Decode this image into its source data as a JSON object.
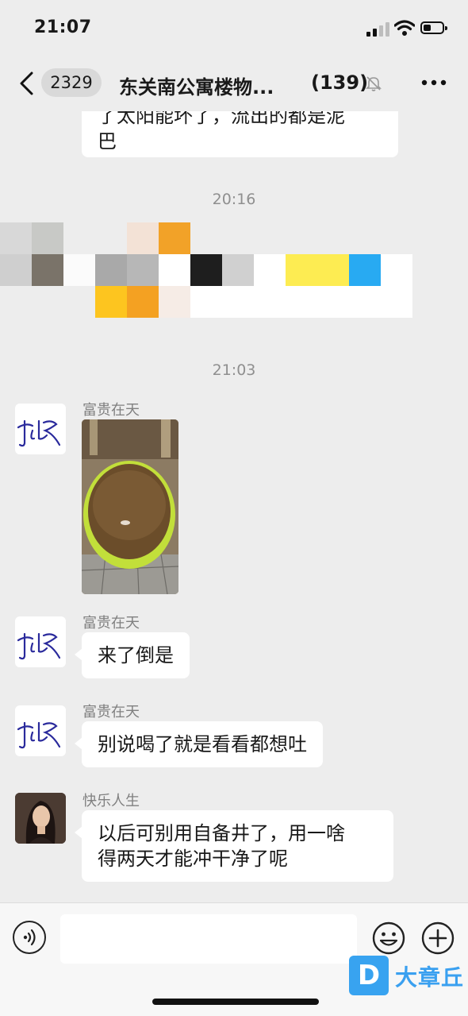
{
  "status_bar": {
    "time": "21:07"
  },
  "nav": {
    "unread_count": "2329",
    "title": "东关南公寓楼物...",
    "member_count": "(139)"
  },
  "messages": {
    "partial_top_line1": "了太阳能坏了，流出的都是泥",
    "partial_top_line2": "巴",
    "time_1": "20:16",
    "time_2": "21:03",
    "m1_sender": "富贵在天",
    "m2_sender": "富贵在天",
    "m2_text": "来了倒是",
    "m3_sender": "富贵在天",
    "m3_text": "别说喝了就是看看都想吐",
    "m4_sender": "快乐人生",
    "m4_line1": "以后可别用自备井了，用一啥",
    "m4_line2": "得两天才能冲干净了呢"
  },
  "watermark": {
    "logo_letter": "D",
    "text": "大章丘"
  },
  "colors": {
    "background": "#ededed",
    "bubble": "#ffffff",
    "timestamp": "#8f8f8f",
    "watermark": "#38a3f0"
  },
  "icons": [
    "back-icon",
    "mute-icon",
    "more-icon",
    "voice-icon",
    "emoji-icon",
    "plus-icon"
  ]
}
